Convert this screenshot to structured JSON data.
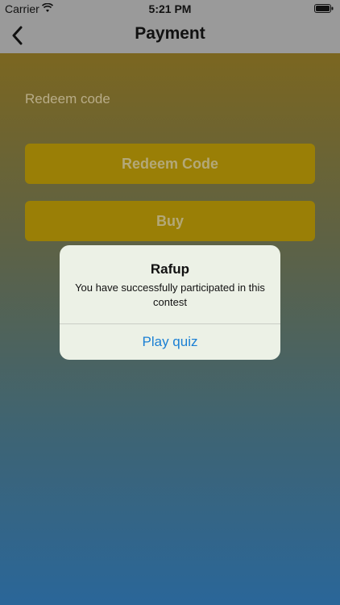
{
  "status_bar": {
    "carrier": "Carrier",
    "time": "5:21 PM",
    "wifi_icon": "wifi-icon",
    "battery_icon": "battery-icon"
  },
  "nav": {
    "title": "Payment",
    "back_icon": "chevron-left-icon"
  },
  "form": {
    "redeem_placeholder": "Redeem code",
    "redeem_button": "Redeem Code",
    "buy_button": "Buy"
  },
  "alert": {
    "title": "Rafup",
    "message": "You have successfully participated in this contest",
    "action": "Play quiz"
  },
  "colors": {
    "accent": "#1a7fd4",
    "button": "#9a7f06",
    "gradient_top": "#7b6620",
    "gradient_bottom": "#2a6699"
  }
}
